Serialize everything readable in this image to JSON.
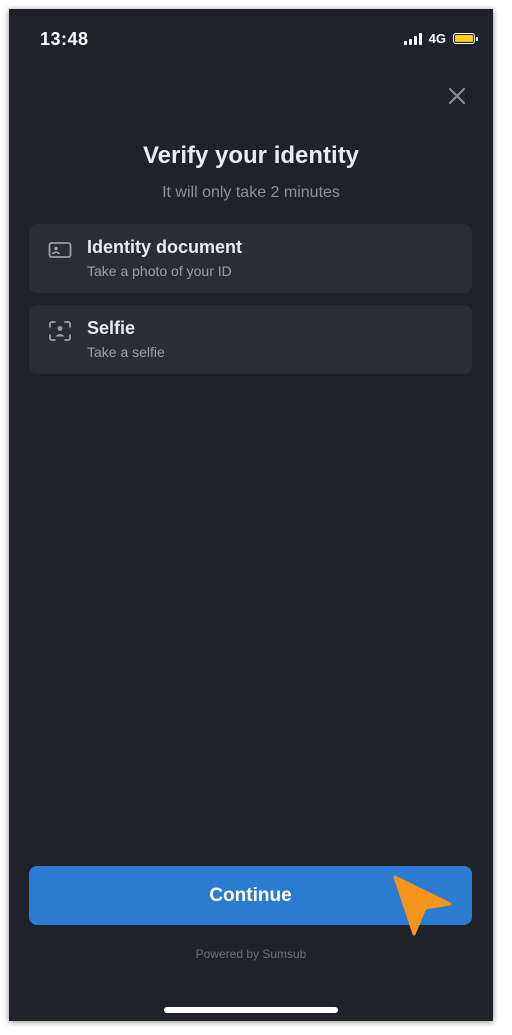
{
  "status_bar": {
    "time": "13:48",
    "network": "4G",
    "icons": [
      "cellular-signal-icon",
      "battery-icon"
    ],
    "battery_color": "#f5cf1a"
  },
  "header": {
    "close_icon": "close-icon",
    "title": "Verify your identity",
    "subtitle": "It will only take 2 minutes"
  },
  "steps": [
    {
      "icon": "id-card-icon",
      "title": "Identity document",
      "description": "Take a photo of your ID"
    },
    {
      "icon": "selfie-icon",
      "title": "Selfie",
      "description": "Take a selfie"
    }
  ],
  "footer": {
    "continue_label": "Continue",
    "powered_by": "Powered by Sumsub"
  },
  "colors": {
    "background": "#1f2229",
    "card": "#2a2d35",
    "accent": "#2b7bd1",
    "cursor": "#f7941d"
  },
  "overlay": {
    "cursor_icon": "cursor-arrow-icon"
  }
}
